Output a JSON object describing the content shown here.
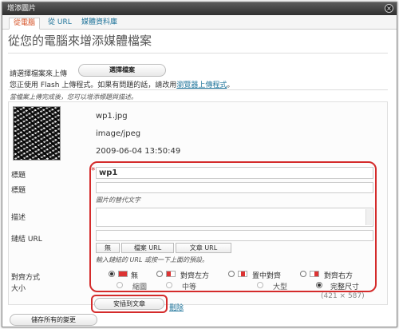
{
  "window": {
    "title": "增添圖片",
    "close": "×"
  },
  "tabs": [
    {
      "label": "從電腦"
    },
    {
      "label": "從 URL"
    },
    {
      "label": "媒體資料庫"
    }
  ],
  "heading": "從您的電腦來增添媒體檔案",
  "upload": {
    "prompt": "請選擇檔案來上傳",
    "select_button": "選擇檔案",
    "flash_note": "您正使用 Flash 上傳程式。如果有問題的話，請改用",
    "browser_link": "瀏覽器上傳程式",
    "flash_note_end": "。",
    "done_note": "當檔案上傳完成後，您可以增添標題與描述。"
  },
  "file": {
    "name": "wp1.jpg",
    "mime": "image/jpeg",
    "date": "2009-06-04 13:50:49"
  },
  "fields": {
    "title_label": "標題",
    "title_value": "wp1",
    "caption_label": "標題",
    "caption_hint": "圖片的替代文字",
    "description_label": "描述",
    "link_label": "鏈結 URL",
    "link_buttons": [
      "無",
      "檔案 URL",
      "文章 URL"
    ],
    "link_hint": "輸入鏈結的 URL 或按一下上面的預設。",
    "align_label": "對齊方式",
    "align_options": [
      "無",
      "對齊左方",
      "置中對齊",
      "對齊右方"
    ],
    "size_label": "大小",
    "size_options": [
      "縮圖",
      "中等",
      "大型",
      "完整尺寸"
    ],
    "size_dims": "(421 × 587)",
    "required_mark": "*"
  },
  "actions": {
    "insert": "安插到文章",
    "delete": "刪除",
    "save_all": "儲存所有的變更"
  },
  "colors": {
    "accent": "#d54e21",
    "link": "#21759b",
    "highlight": "#d42b2b"
  }
}
